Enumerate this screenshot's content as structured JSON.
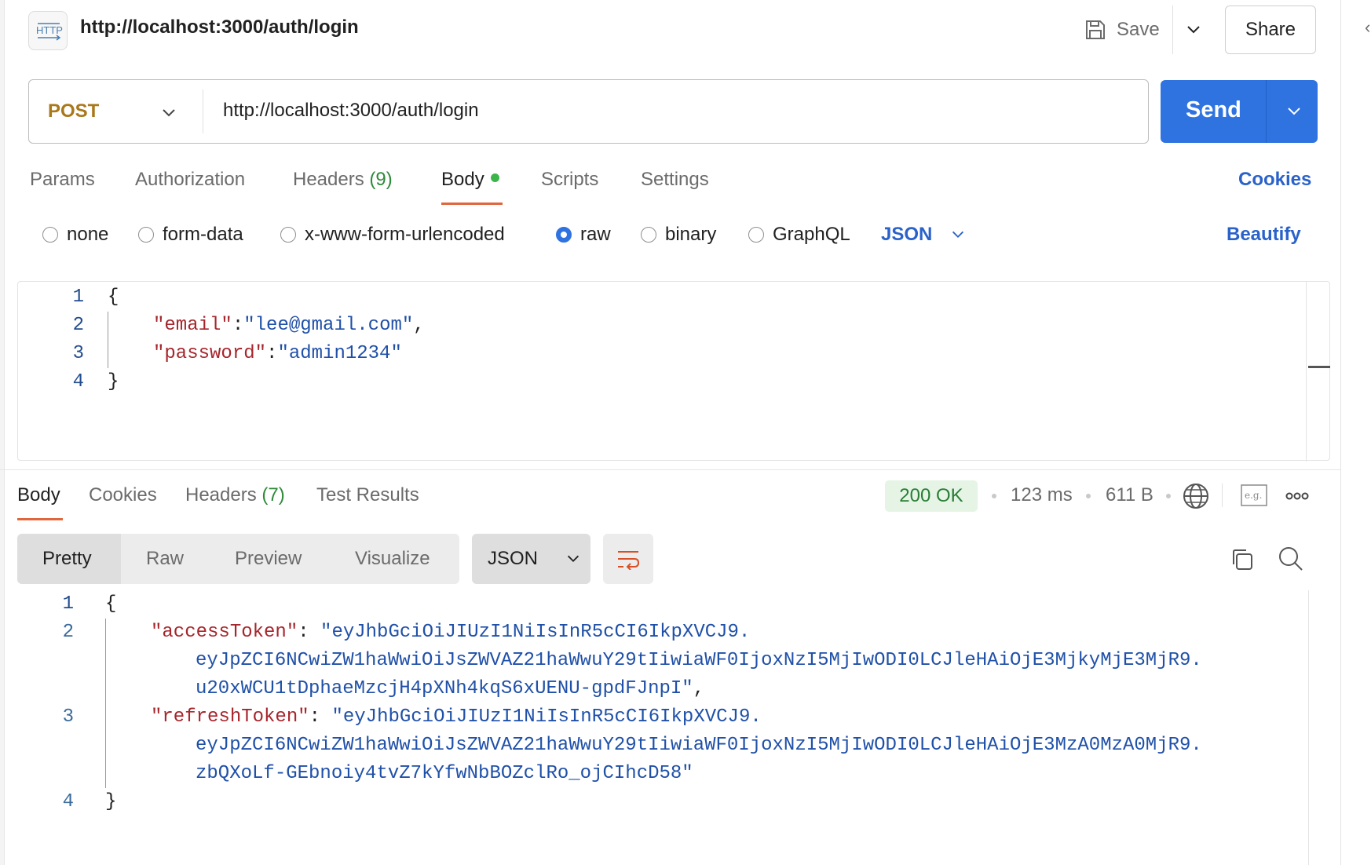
{
  "header": {
    "title": "http://localhost:3000/auth/login",
    "icon": "http-icon",
    "save_label": "Save",
    "share_label": "Share"
  },
  "request": {
    "method": "POST",
    "url": "http://localhost:3000/auth/login",
    "send_label": "Send",
    "tabs": [
      {
        "label": "Params"
      },
      {
        "label": "Authorization"
      },
      {
        "label": "Headers",
        "count": "(9)"
      },
      {
        "label": "Body",
        "active": true
      },
      {
        "label": "Scripts"
      },
      {
        "label": "Settings"
      }
    ],
    "cookies_label": "Cookies",
    "body_types": [
      "none",
      "form-data",
      "x-www-form-urlencoded",
      "raw",
      "binary",
      "GraphQL"
    ],
    "selected_body_type": "raw",
    "body_format": "JSON",
    "beautify_label": "Beautify",
    "body_lines": [
      {
        "n": "1",
        "text": "{"
      },
      {
        "n": "2",
        "key": "\"email\"",
        "sep": ":",
        "value": "\"lee@gmail.com\"",
        "tail": ","
      },
      {
        "n": "3",
        "key": "\"password\"",
        "sep": ":",
        "value": "\"admin1234\"",
        "tail": ""
      },
      {
        "n": "4",
        "text": "}"
      }
    ]
  },
  "response": {
    "tabs": [
      {
        "label": "Body",
        "active": true
      },
      {
        "label": "Cookies"
      },
      {
        "label": "Headers",
        "count": "(7)"
      },
      {
        "label": "Test Results"
      }
    ],
    "status": "200 OK",
    "time": "123 ms",
    "size": "611 B",
    "view_modes": [
      "Pretty",
      "Raw",
      "Preview",
      "Visualize"
    ],
    "selected_view": "Pretty",
    "format": "JSON",
    "lines": {
      "l1": "{",
      "l4": "}",
      "access_key": "\"accessToken\"",
      "access_v1": "\"eyJhbGciOiJIUzI1NiIsInR5cCI6IkpXVCJ9.",
      "access_v2": "eyJpZCI6NCwiZW1haWwiOiJsZWVAZ21haWwuY29tIiwiaWF0IjoxNzI5MjIwODI0LCJleHAiOjE3MjkyMjE3MjR9.",
      "access_v3": "u20xWCU1tDphaeMzcjH4pXNh4kqS6xUENU-gpdFJnpI\"",
      "refresh_key": "\"refreshToken\"",
      "refresh_v1": "\"eyJhbGciOiJIUzI1NiIsInR5cCI6IkpXVCJ9.",
      "refresh_v2": "eyJpZCI6NCwiZW1haWwiOiJsZWVAZ21haWwuY29tIiwiaWF0IjoxNzI5MjIwODI0LCJleHAiOjE3MzA0MzA0MjR9.",
      "refresh_v3": "zbQXoLf-GEbnoiy4tvZ7kYfwNbBOZclRo_ojCIhcD58\""
    }
  },
  "colors": {
    "accent": "#2f73e0",
    "method": "#a9781a",
    "tab_underline": "#e0663d",
    "status_ok": "#2a7d36",
    "json_key": "#a6262c",
    "json_string": "#1f50a8"
  }
}
